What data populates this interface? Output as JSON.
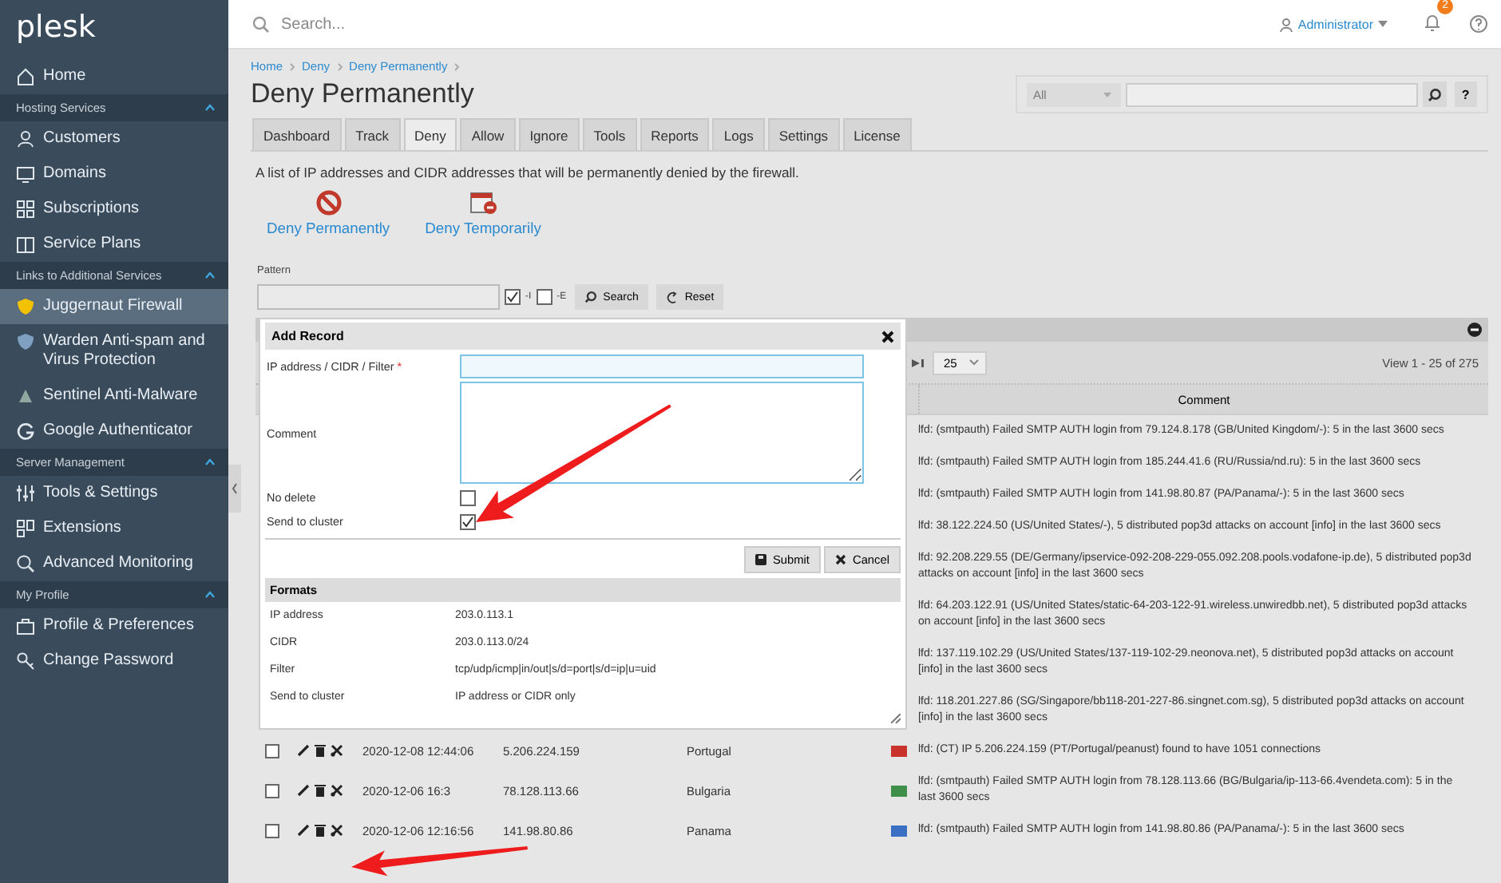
{
  "sidebar": {
    "logo": "plesk",
    "items": [
      {
        "kind": "item",
        "label": "Home",
        "selected": false
      },
      {
        "kind": "header",
        "label": "Hosting Services",
        "expanded": true
      },
      {
        "kind": "item",
        "label": "Customers",
        "selected": false
      },
      {
        "kind": "item",
        "label": "Domains",
        "selected": false
      },
      {
        "kind": "item",
        "label": "Subscriptions",
        "selected": false
      },
      {
        "kind": "item",
        "label": "Service Plans",
        "selected": false
      },
      {
        "kind": "header",
        "label": "Links to Additional Services",
        "expanded": true
      },
      {
        "kind": "item",
        "label": "Juggernaut Firewall",
        "selected": true
      },
      {
        "kind": "item",
        "label": "Warden Anti-spam and Virus Protection",
        "selected": false
      },
      {
        "kind": "item",
        "label": "Sentinel Anti-Malware",
        "selected": false
      },
      {
        "kind": "item",
        "label": "Google Authenticator",
        "selected": false
      },
      {
        "kind": "header",
        "label": "Server Management",
        "expanded": true
      },
      {
        "kind": "item",
        "label": "Tools & Settings",
        "selected": false
      },
      {
        "kind": "item",
        "label": "Extensions",
        "selected": false
      },
      {
        "kind": "item",
        "label": "Advanced Monitoring",
        "selected": false
      },
      {
        "kind": "header",
        "label": "My Profile",
        "expanded": true
      },
      {
        "kind": "item",
        "label": "Profile & Preferences",
        "selected": false
      },
      {
        "kind": "item",
        "label": "Change Password",
        "selected": false
      }
    ]
  },
  "topbar": {
    "search": {
      "placeholder": "Search..."
    },
    "user": "Administrator",
    "notifications": "2"
  },
  "breadcrumb": [
    "Home",
    "Deny",
    "Deny Permanently"
  ],
  "title": "Deny Permanently",
  "filter": {
    "select": "All",
    "help": "?"
  },
  "tabs": [
    {
      "label": "Dashboard",
      "selected": false
    },
    {
      "label": "Track",
      "selected": false
    },
    {
      "label": "Deny",
      "selected": true
    },
    {
      "label": "Allow",
      "selected": false
    },
    {
      "label": "Ignore",
      "selected": false
    },
    {
      "label": "Tools",
      "selected": false
    },
    {
      "label": "Reports",
      "selected": false
    },
    {
      "label": "Logs",
      "selected": false
    },
    {
      "label": "Settings",
      "selected": false
    },
    {
      "label": "License",
      "selected": false
    }
  ],
  "description": "A list of IP addresses and CIDR addresses that will be permanently denied by the firewall.",
  "actions": [
    {
      "label": "Deny Permanently"
    },
    {
      "label": "Deny Temporarily"
    }
  ],
  "pattern": {
    "label": "Pattern",
    "options": [
      {
        "label": "-I",
        "checked": true
      },
      {
        "label": "-E",
        "checked": false
      }
    ],
    "buttons": [
      "Search",
      "Reset"
    ]
  },
  "grid": {
    "page_size": "25",
    "view": "View 1 - 25 of 275",
    "comment_column": "Comment",
    "rows": [
      {
        "comment": "lfd: (smtpauth) Failed SMTP AUTH login from 79.124.8.178 (GB/United Kingdom/-): 5 in the last 3600 secs"
      },
      {
        "comment": "lfd: (smtpauth) Failed SMTP AUTH login from 185.244.41.6 (RU/Russia/nd.ru): 5 in the last 3600 secs"
      },
      {
        "comment": "lfd: (smtpauth) Failed SMTP AUTH login from 141.98.80.87 (PA/Panama/-): 5 in the last 3600 secs"
      },
      {
        "comment": "lfd: 38.122.224.50 (US/United States/-), 5 distributed pop3d attacks on account [info] in the last 3600 secs"
      },
      {
        "comment": "lfd: 92.208.229.55 (DE/Germany/ipservice-092-208-229-055.092.208.pools.vodafone-ip.de), 5 distributed pop3d attacks on account [info] in the last 3600 secs"
      },
      {
        "comment": "lfd: 64.203.122.91 (US/United States/static-64-203-122-91.wireless.unwiredbb.net), 5 distributed pop3d attacks on account [info] in the last 3600 secs"
      },
      {
        "comment": "lfd: 137.119.102.29 (US/United States/137-119-102-29.neonova.net), 5 distributed pop3d attacks on account [info] in the last 3600 secs"
      },
      {
        "comment": "lfd: 118.201.227.86 (SG/Singapore/bb118-201-227-86.singnet.com.sg), 5 distributed pop3d attacks on account [info] in the last 3600 secs"
      },
      {
        "checked": false,
        "date": "2020-12-08 12:44:06",
        "ip": "5.206.224.159",
        "country": "Portugal",
        "color": "#c8342c",
        "comment": "lfd: (CT) IP 5.206.224.159 (PT/Portugal/peanust) found to have 1051 connections"
      },
      {
        "checked": false,
        "date": "2020-12-06 16:3",
        "ip": "78.128.113.66",
        "country": "Bulgaria",
        "color": "#3d8f4a",
        "comment": "lfd: (smtpauth) Failed SMTP AUTH login from 78.128.113.66 (BG/Bulgaria/ip-113-66.4vendeta.com): 5 in the last 3600 secs"
      },
      {
        "checked": false,
        "date": "2020-12-06 12:16:56",
        "ip": "141.98.80.86",
        "country": "Panama",
        "color": "#3a6fc4",
        "comment": "lfd: (smtpauth) Failed SMTP AUTH login from 141.98.80.86 (PA/Panama/-): 5 in the last 3600 secs"
      }
    ]
  },
  "dialog": {
    "title": "Add Record",
    "required_mark": "*",
    "fields": [
      {
        "kind": "input",
        "label": "IP address / CIDR / Filter",
        "required": true
      },
      {
        "kind": "textarea",
        "label": "Comment",
        "required": false
      },
      {
        "kind": "checkbox",
        "label": "No delete",
        "checked": false
      },
      {
        "kind": "checkbox",
        "label": "Send to cluster",
        "checked": true
      }
    ],
    "buttons": [
      "Submit",
      "Cancel"
    ],
    "formats": {
      "title": "Formats",
      "rows": [
        {
          "name": "IP address",
          "value": "203.0.113.1"
        },
        {
          "name": "CIDR",
          "value": "203.0.113.0/24"
        },
        {
          "name": "Filter",
          "value": "tcp/udp/icmp|in/out|s/d=port|s/d=ip|u=uid"
        },
        {
          "name": "Send to cluster",
          "value": "IP address or CIDR only"
        }
      ]
    }
  }
}
